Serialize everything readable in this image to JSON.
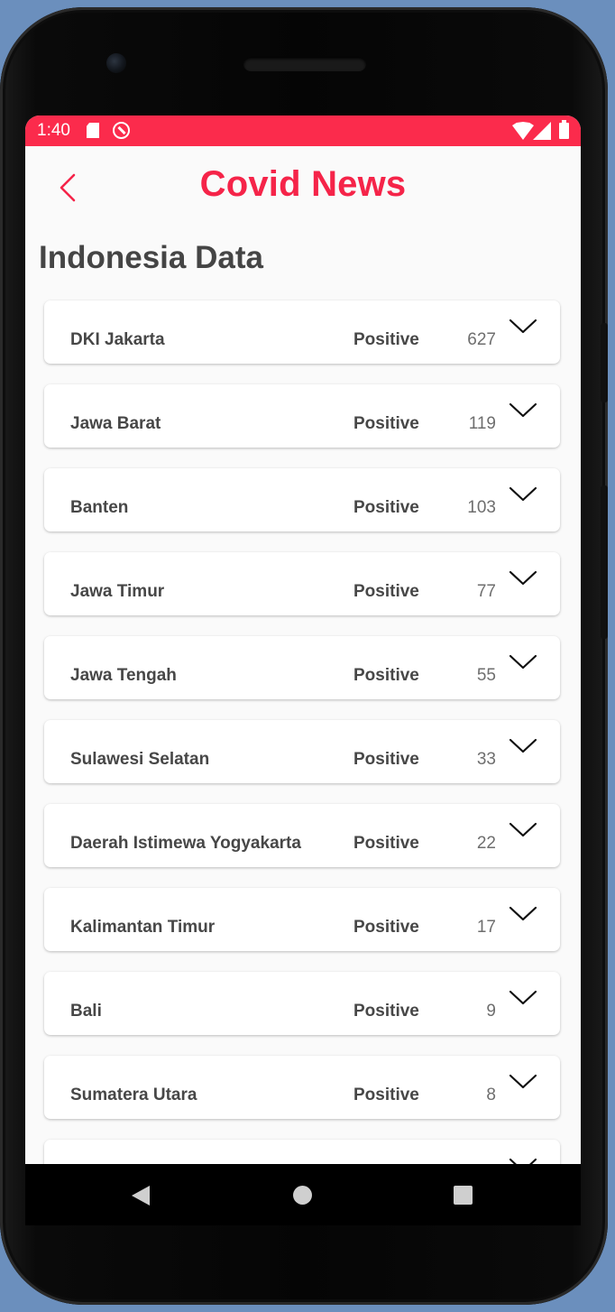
{
  "status_bar": {
    "time": "1:40",
    "icons": [
      "sd-card-icon",
      "sync-icon",
      "wifi-icon",
      "signal-icon",
      "battery-icon"
    ]
  },
  "app_bar": {
    "title": "Covid News",
    "back_icon": "chevron-left-icon"
  },
  "section": {
    "title": "Indonesia Data"
  },
  "provinces": [
    {
      "name": "DKI Jakarta",
      "label": "Positive",
      "count": "627"
    },
    {
      "name": "Jawa Barat",
      "label": "Positive",
      "count": "119"
    },
    {
      "name": "Banten",
      "label": "Positive",
      "count": "103"
    },
    {
      "name": "Jawa Timur",
      "label": "Positive",
      "count": "77"
    },
    {
      "name": "Jawa Tengah",
      "label": "Positive",
      "count": "55"
    },
    {
      "name": "Sulawesi Selatan",
      "label": "Positive",
      "count": "33"
    },
    {
      "name": "Daerah Istimewa Yogyakarta",
      "label": "Positive",
      "count": "22"
    },
    {
      "name": "Kalimantan Timur",
      "label": "Positive",
      "count": "17"
    },
    {
      "name": "Bali",
      "label": "Positive",
      "count": "9"
    },
    {
      "name": "Sumatera Utara",
      "label": "Positive",
      "count": "8"
    },
    {
      "name": "",
      "label": "",
      "count": ""
    }
  ],
  "nav_bar": {
    "icons": [
      "back-triangle-icon",
      "home-circle-icon",
      "recents-square-icon"
    ]
  },
  "colors": {
    "accent": "#f52449",
    "status_bar": "#fb2b4c",
    "background": "#fafafa",
    "text_dark": "#474747",
    "text_count": "#6e6e6e"
  }
}
